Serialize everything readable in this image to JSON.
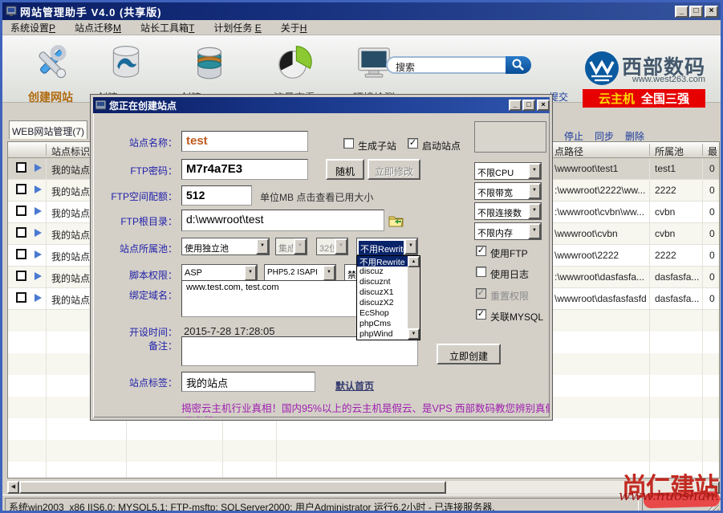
{
  "window": {
    "title": "网站管理助手 V4.0 (共享版)"
  },
  "menu": [
    {
      "label": "系统设置",
      "key": "P"
    },
    {
      "label": "站点迁移",
      "key": "M"
    },
    {
      "label": "站长工具箱",
      "key": "T"
    },
    {
      "label": "计划任务 ",
      "key": "E"
    },
    {
      "label": "关于",
      "key": "H"
    }
  ],
  "toolbar": {
    "items": [
      "创建网站",
      "创建MYSQL",
      "创建MSSQL",
      "流量查看",
      "环境检测"
    ],
    "search": "搜索"
  },
  "brand": {
    "name": "西部数码",
    "url": "www.west263.com",
    "banner_gold": "云主机",
    "banner_white": "全国三强",
    "partial": "提交"
  },
  "sites": {
    "tab": "WEB网站管理(7)",
    "links": [
      "停止",
      "同步",
      "删除"
    ],
    "header": {
      "id": "站点标识",
      "path": "点路径",
      "pool": "所属池",
      "max": "最"
    },
    "rows": [
      {
        "id": "我的站点",
        "path": "\\wwwroot\\test1",
        "pool": "test1",
        "max": "0"
      },
      {
        "id": "我的站点",
        "path": ":\\wwwroot\\2222\\ww...",
        "pool": "2222",
        "max": "0"
      },
      {
        "id": "我的站点",
        "path": ":\\wwwroot\\cvbn\\ww...",
        "pool": "cvbn",
        "max": "0"
      },
      {
        "id": "我的站点",
        "path": "\\wwwroot\\cvbn",
        "pool": "cvbn",
        "max": "0"
      },
      {
        "id": "我的站点",
        "path": "\\wwwroot\\2222",
        "pool": "2222",
        "max": "0"
      },
      {
        "id": "我的站点",
        "path": ":\\wwwroot\\dasfasfa...",
        "pool": "dasfasfa...",
        "max": "0"
      },
      {
        "id": "我的站点",
        "path": "\\wwwroot\\dasfasfasfd",
        "pool": "dasfasfa...",
        "max": "0"
      }
    ]
  },
  "dlg": {
    "title": "您正在创建站点",
    "labels": {
      "name": "站点名称：",
      "pwd": "FTP密码：",
      "quota": "FTP空间配额：",
      "root": "FTP根目录：",
      "pool": "站点所属池：",
      "script": "脚本权限：",
      "domain": "绑定域名：",
      "time": "开设时间：",
      "note": "备注：",
      "tag": "站点标签："
    },
    "values": {
      "name": "test",
      "pwd": "M7r4a7E3",
      "quota": "512",
      "root": "d:\\wwwroot\\test",
      "domain": "www.test.com, test.com",
      "time": "2015-7-28 17:28:05",
      "tag": "我的站点"
    },
    "checks": {
      "sub": "生成子站",
      "start": "启动站点",
      "ftp": "使用FTP",
      "log": "使用日志",
      "reset": "重置权限",
      "mysql": "关联MYSQL"
    },
    "buttons": {
      "random": "随机",
      "modify": "立即修改",
      "create": "立即创建"
    },
    "combos": {
      "pool": "使用独立池",
      "mode": "集成",
      "bits": "32位",
      "rewrite": "不用Rewrite",
      "asp": "ASP",
      "php": "PHP5.2 ISAPI",
      "forbid": "禁"
    },
    "limits": [
      "不限CPU",
      "不限带宽",
      "不限连接数",
      "不限内存"
    ],
    "rewrite_options": [
      "不用Rewrite",
      "discuz",
      "discuznt",
      "discuzX1",
      "discuzX2",
      "EcShop",
      "phpCms",
      "phpWind"
    ],
    "quota_hint": "单位MB 点击查看已用大小",
    "home_link": "默认首页",
    "promo": "揭密云主机行业真相！国内95%以上的云主机是假云、是VPS 西部数码教您辨别真假",
    "promo2": "云主机"
  },
  "status": {
    "text": "系统win2003_x86 IIS6.0; MYSQL5.1; FTP-msftp; SQLServer2000; 用户Administrator 运行6.2小时 - 已连接服务器."
  },
  "wm": {
    "title": "尚仁建站",
    "url": "www.huoshan.info"
  }
}
